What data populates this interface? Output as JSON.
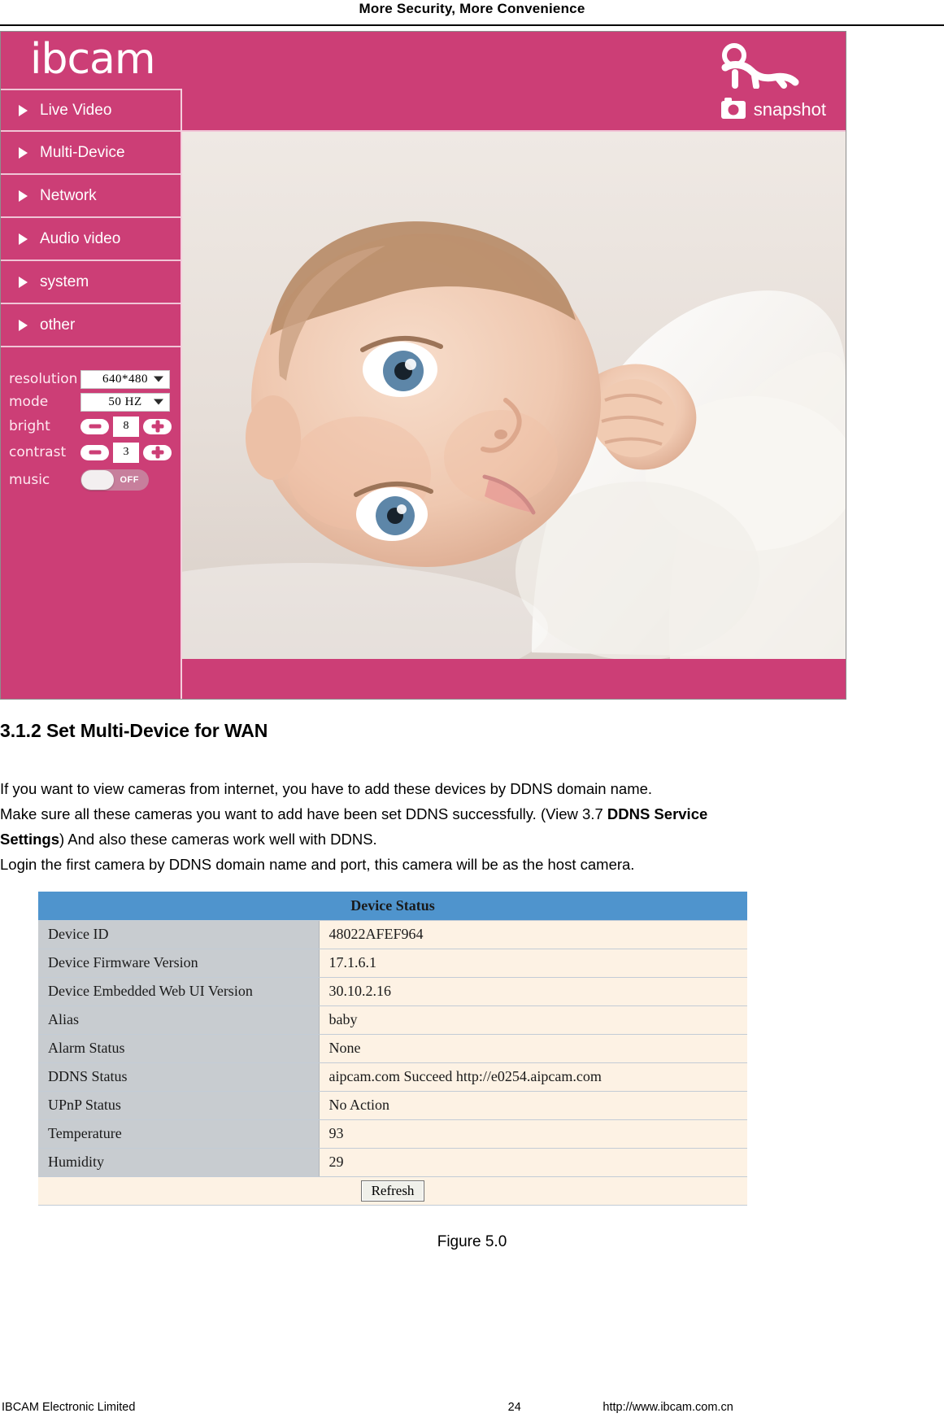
{
  "page": {
    "running_head": "More Security, More Convenience",
    "footer": {
      "company": "IBCAM Electronic Limited",
      "page_number": "24",
      "url": "http://www.ibcam.com.cn"
    }
  },
  "camera_ui": {
    "logo": "ibcam",
    "brand_color": "#CC3E76",
    "menu": [
      {
        "label": "Live Video"
      },
      {
        "label": "Multi-Device"
      },
      {
        "label": "Network"
      },
      {
        "label": "Audio video"
      },
      {
        "label": "system"
      },
      {
        "label": "other"
      }
    ],
    "snapshot_label": "snapshot",
    "controls": {
      "resolution": {
        "label": "resolution",
        "value": "640*480"
      },
      "mode": {
        "label": "mode",
        "value": "50  HZ"
      },
      "bright": {
        "label": "bright",
        "value": "8",
        "minus": "-",
        "plus": "+"
      },
      "contrast": {
        "label": "contrast",
        "value": "3",
        "minus": "-",
        "plus": "+"
      },
      "music": {
        "label": "music",
        "state": "OFF"
      }
    }
  },
  "document": {
    "section_heading": "3.1.2 Set Multi-Device for WAN",
    "paragraph": {
      "line1": "If you want to view cameras from internet, you have to add these devices by DDNS domain name.",
      "line2a": "Make sure all these cameras you want to add have been set DDNS successfully. (View 3.7 ",
      "line2b": "DDNS Service",
      "line3a": "Settings",
      "line3b": ") And also these cameras work well with DDNS.",
      "line4": "Login the first camera by DDNS domain name and port, this camera will be as the host camera."
    },
    "figure_caption": "Figure 5.0"
  },
  "device_status": {
    "title": "Device Status",
    "rows": [
      {
        "key": "Device ID",
        "value": "48022AFEF964"
      },
      {
        "key": "Device Firmware Version",
        "value": "17.1.6.1"
      },
      {
        "key": "Device Embedded Web UI Version",
        "value": "30.10.2.16"
      },
      {
        "key": "Alias",
        "value": "baby"
      },
      {
        "key": "Alarm Status",
        "value": "None"
      },
      {
        "key": "DDNS Status",
        "value": "aipcam.com  Succeed  http://e0254.aipcam.com"
      },
      {
        "key": "UPnP Status",
        "value": "No Action"
      },
      {
        "key": "Temperature",
        "value": "93"
      },
      {
        "key": "Humidity",
        "value": "29"
      }
    ],
    "refresh_label": "Refresh"
  }
}
